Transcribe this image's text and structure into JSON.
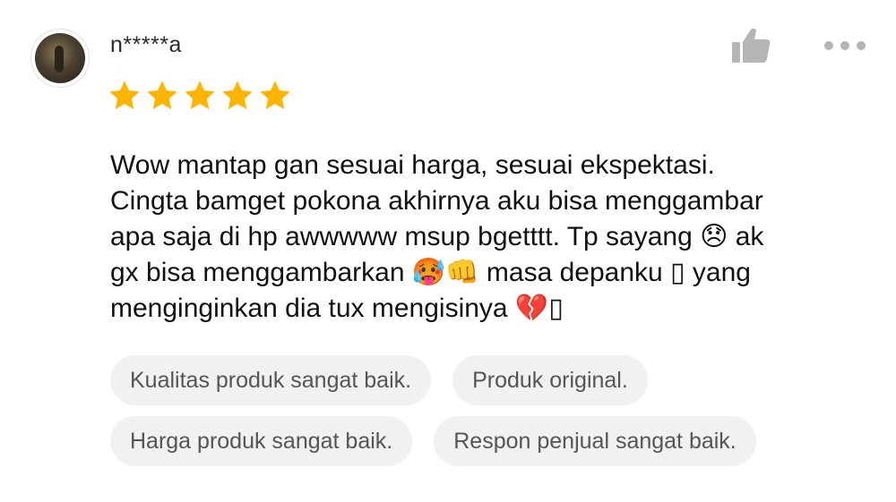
{
  "review": {
    "username": "n*****a",
    "rating": 5,
    "max_rating": 5,
    "text_lines": [
      "Wow mantap gan sesuai harga, sesuai ekspektasi.",
      "Cingta bamget pokona akhirnya aku bisa menggambar",
      "apa saja di hp awwwww msup bgetttt. Tp sayang 😞 ak",
      "gx bisa menggambarkan 🥵👊 masa depanku ▯ yang",
      "menginginkan dia tux mengisinya 💔▯"
    ]
  },
  "tags": {
    "row1": [
      "Kualitas produk sangat baik.",
      "Produk original."
    ],
    "row2": [
      "Harga produk sangat baik.",
      "Respon penjual sangat baik."
    ]
  },
  "icons": {
    "like": "thumbs-up-icon",
    "more": "more-dots-icon",
    "star": "star-icon",
    "avatar": "user-avatar"
  },
  "colors": {
    "star": "#FFB400",
    "icon_gray": "#b5b5b5",
    "tag_bg": "#f1f1f1",
    "tag_text": "#555555"
  }
}
